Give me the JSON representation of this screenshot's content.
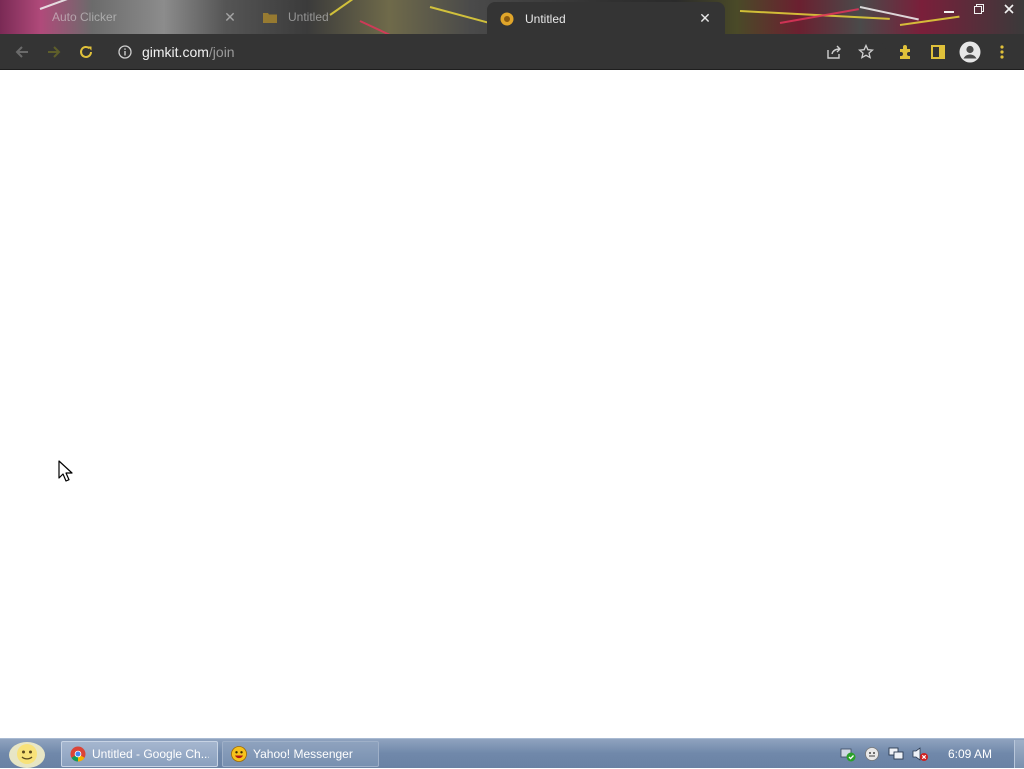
{
  "browser": {
    "tabs": [
      {
        "label": "Auto Clicker",
        "state": "inactive"
      },
      {
        "label": "Untitled",
        "state": "inactive"
      },
      {
        "label": "Untitled",
        "state": "active"
      }
    ],
    "window_controls": {
      "minimize": "minimize-icon",
      "restore": "restore-icon",
      "close": "close-icon"
    },
    "address": {
      "host": "gimkit.com",
      "path": "/join"
    },
    "toolbar_icons": [
      "back-icon",
      "forward-icon",
      "reload-icon",
      "share-icon",
      "bookmark-star-icon",
      "extensions-icon",
      "side-panel-icon",
      "profile-icon",
      "menu-icon"
    ]
  },
  "taskbar": {
    "buttons": [
      {
        "label": "Untitled - Google Ch...",
        "icon": "chrome-icon",
        "active": true
      },
      {
        "label": "Yahoo! Messenger",
        "icon": "yahoo-messenger-icon",
        "active": false
      }
    ],
    "tray_icons": [
      "network-icon",
      "messenger-tray-icon",
      "display-icon",
      "volume-muted-icon"
    ],
    "clock": "6:09 AM"
  },
  "colors": {
    "toolbar_bg": "#343434",
    "taskbar_bg": "#7088aa",
    "page_bg": "#ffffff"
  }
}
